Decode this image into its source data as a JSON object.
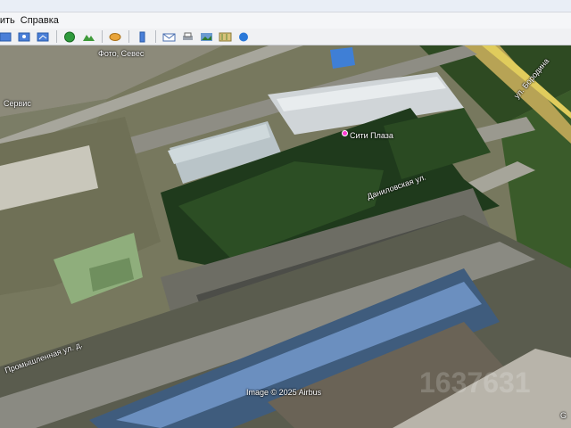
{
  "menu": {
    "items": [
      "вить",
      "Справка"
    ]
  },
  "toolbar": {
    "icons": [
      "nav-icon",
      "placemark-icon",
      "path-icon",
      "globe-icon",
      "terrain-icon",
      "planet-icon",
      "ruler-icon",
      "email-icon",
      "print-icon",
      "image-icon",
      "map-icon",
      "earth-icon"
    ]
  },
  "map": {
    "labels": {
      "top_left": "Фото, Севес",
      "left_mid": "Сервис",
      "poi": "Сити Плаза",
      "street_main": "Даниловская ул.",
      "street_left": "Промышленная ул. д.",
      "street_right": "ул. Бородина"
    },
    "attribution": "Image © 2025 Airbus",
    "watermark": "1637631",
    "corner": "G"
  }
}
